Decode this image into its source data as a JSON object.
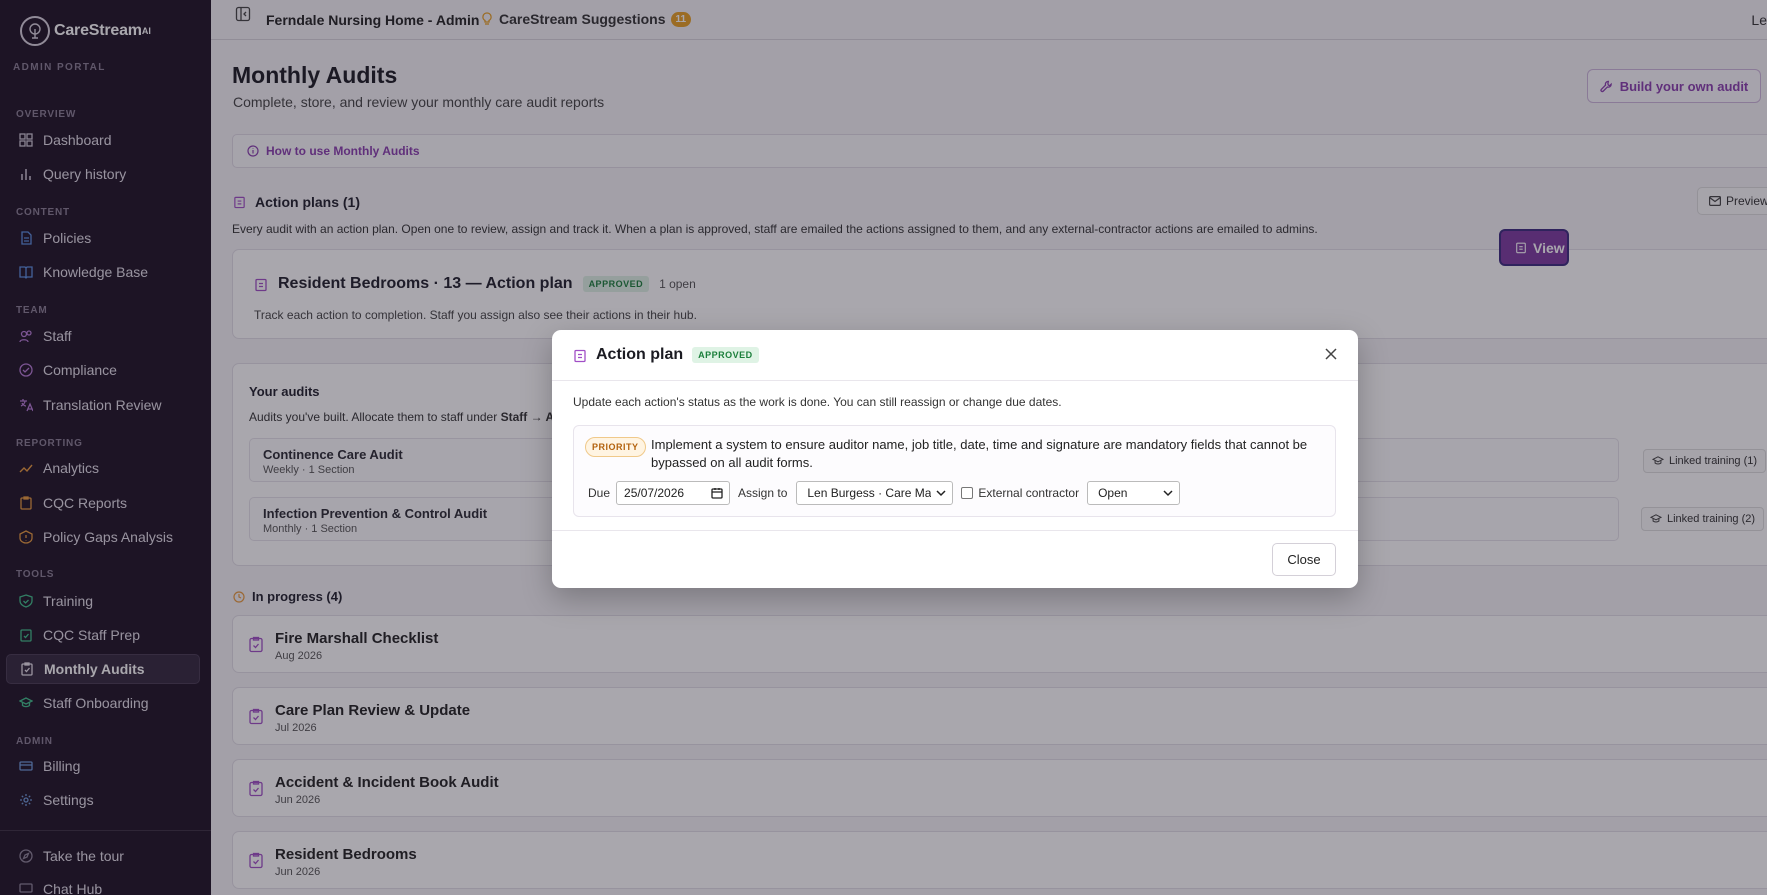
{
  "app": {
    "name": "CareStream",
    "name_suffix": "AI",
    "portal": "ADMIN PORTAL"
  },
  "sidebar": {
    "sections": [
      {
        "label": "OVERVIEW"
      },
      {
        "label": "CONTENT"
      },
      {
        "label": "TEAM"
      },
      {
        "label": "REPORTING"
      },
      {
        "label": "TOOLS"
      },
      {
        "label": "ADMIN"
      }
    ],
    "items": [
      {
        "label": "Dashboard",
        "icon": "grid-icon"
      },
      {
        "label": "Query history",
        "icon": "bar-chart-icon"
      },
      {
        "label": "Policies",
        "icon": "document-icon"
      },
      {
        "label": "Knowledge Base",
        "icon": "book-icon"
      },
      {
        "label": "Staff",
        "icon": "users-icon"
      },
      {
        "label": "Compliance",
        "icon": "check-circle-icon"
      },
      {
        "label": "Translation Review",
        "icon": "translate-icon"
      },
      {
        "label": "Analytics",
        "icon": "trend-icon"
      },
      {
        "label": "CQC Reports",
        "icon": "clipboard-icon"
      },
      {
        "label": "Policy Gaps Analysis",
        "icon": "alert-icon"
      },
      {
        "label": "Training",
        "icon": "shield-icon"
      },
      {
        "label": "CQC Staff Prep",
        "icon": "clipboard-check-icon"
      },
      {
        "label": "Monthly Audits",
        "icon": "clipboard-icon",
        "active": true
      },
      {
        "label": "Staff Onboarding",
        "icon": "graduation-icon"
      },
      {
        "label": "Billing",
        "icon": "card-icon"
      },
      {
        "label": "Settings",
        "icon": "gear-icon"
      },
      {
        "label": "Take the tour",
        "icon": "compass-icon"
      },
      {
        "label": "Chat Hub",
        "icon": "chat-icon"
      }
    ]
  },
  "topbar": {
    "org": "Ferndale Nursing Home - Admin",
    "suggestions": "CareStream Suggestions",
    "suggestions_count": "11",
    "user": "Le"
  },
  "page": {
    "title": "Monthly Audits",
    "subtitle": "Complete, store, and review your monthly care audit reports",
    "build_button": "Build your own audit",
    "howto": "How to use Monthly Audits"
  },
  "action_plans": {
    "heading": "Action plans (1)",
    "preview": "Preview",
    "description": "Every audit with an action plan. Open one to review, assign and track it. When a plan is approved, staff are emailed the actions assigned to them, and any external-contractor actions are emailed to admins.",
    "plan": {
      "title": "Resident Bedrooms · 13 — Action plan",
      "status": "APPROVED",
      "open": "1 open",
      "description": "Track each action to completion. Staff you assign also see their actions in their hub.",
      "view": "View"
    }
  },
  "your_audits": {
    "heading": "Your audits",
    "description_prefix": "Audits you've built. Allocate them to staff under ",
    "description_bold": "Staff → Ac",
    "rows": [
      {
        "name": "Continence Care Audit",
        "meta": "Weekly · 1 Section",
        "training": "Linked training (1)"
      },
      {
        "name": "Infection Prevention & Control Audit",
        "meta": "Monthly · 1 Section",
        "training": "Linked training (2)"
      }
    ]
  },
  "in_progress": {
    "heading": "In progress (4)",
    "items": [
      {
        "name": "Fire Marshall Checklist",
        "date": "Aug 2026"
      },
      {
        "name": "Care Plan Review & Update",
        "date": "Jul 2026"
      },
      {
        "name": "Accident & Incident Book Audit",
        "date": "Jun 2026"
      },
      {
        "name": "Resident Bedrooms",
        "date": "Jun 2026"
      }
    ]
  },
  "modal": {
    "title": "Action plan",
    "status": "APPROVED",
    "description": "Update each action's status as the work is done. You can still reassign or change due dates.",
    "action": {
      "priority": "PRIORITY",
      "text": "Implement a system to ensure auditor name, job title, date, time and signature are mandatory fields that cannot be bypassed on all audit forms.",
      "due_label": "Due",
      "due_value": "25/07/2026",
      "assign_label": "Assign to",
      "assign_value": "Len Burgess · Care Mana",
      "external_label": "External contractor",
      "external_checked": false,
      "status_value": "Open"
    },
    "close": "Close"
  },
  "colors": {
    "accent": "#8a3fae",
    "sidebar_bg": "#1d1225",
    "approved": "#1b7f3b",
    "priority": "#b3620d",
    "badge": "#e8a123"
  }
}
